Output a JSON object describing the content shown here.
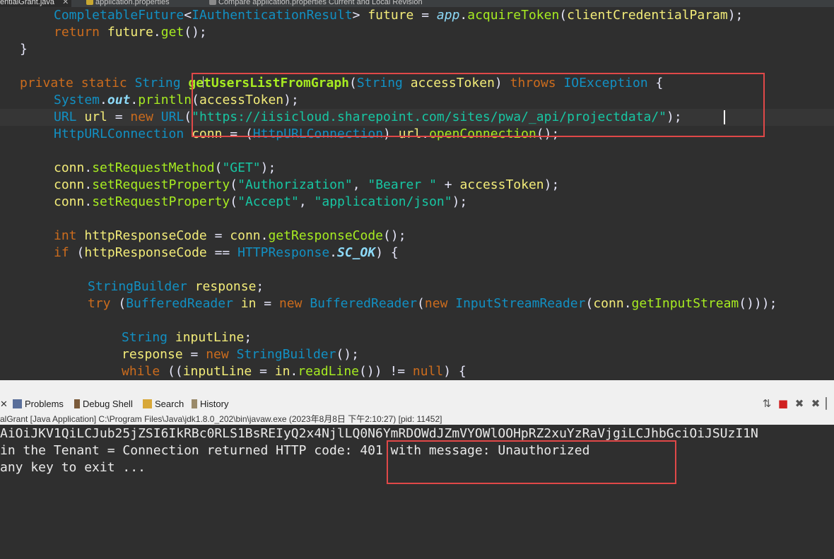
{
  "editor_tabs": [
    {
      "label": "entialGrant.java",
      "close": "✕"
    },
    {
      "label": "application.properties"
    },
    {
      "label": "Compare application.properties Current and Local Revision"
    }
  ],
  "code": {
    "l1": {
      "a": "CompletableFuture",
      "b": "<",
      "c": "IAuthenticationResult",
      "d": "> ",
      "e": "future",
      "f": " = ",
      "g": "app",
      "h": ".",
      "i": "acquireToken",
      "j": "(",
      "k": "clientCredentialParam",
      "l": ");"
    },
    "l2": {
      "a": "return ",
      "b": "future",
      "c": ".",
      "d": "get",
      "e": "();"
    },
    "l3": {
      "a": "}"
    },
    "l5": {
      "a": "private ",
      "b": "static ",
      "c": "String ",
      "d": "getUsersListFromGraph",
      "e": "(",
      "f": "String ",
      "g": "accessToken",
      "h": ") ",
      "i": "throws ",
      "j": "IOException",
      "k": " {"
    },
    "l6": {
      "a": "System",
      "b": ".",
      "c": "out",
      "d": ".",
      "e": "println",
      "f": "(",
      "g": "accessToken",
      "h": ");"
    },
    "l7": {
      "a": "URL ",
      "b": "url",
      "c": " = ",
      "d": "new ",
      "e": "URL",
      "f": "(",
      "g": "\"https://iisicloud.sharepoint.com/sites/pwa/_api/projectdata/\"",
      "h": ");"
    },
    "l8": {
      "a": "HttpURLConnection ",
      "b": "conn",
      "c": " = (",
      "d": "HttpURLConnection",
      "e": ") ",
      "f": "url",
      "g": ".",
      "h": "openConnection",
      "i": "();"
    },
    "l10": {
      "a": "conn",
      "b": ".",
      "c": "setRequestMethod",
      "d": "(",
      "e": "\"GET\"",
      "f": ");"
    },
    "l11": {
      "a": "conn",
      "b": ".",
      "c": "setRequestProperty",
      "d": "(",
      "e": "\"Authorization\"",
      "f": ", ",
      "g": "\"Bearer \"",
      "h": " + ",
      "i": "accessToken",
      "j": ");"
    },
    "l12": {
      "a": "conn",
      "b": ".",
      "c": "setRequestProperty",
      "d": "(",
      "e": "\"Accept\"",
      "f": ", ",
      "g": "\"application/json\"",
      "h": ");"
    },
    "l14": {
      "a": "int ",
      "b": "httpResponseCode",
      "c": " = ",
      "d": "conn",
      "e": ".",
      "f": "getResponseCode",
      "g": "();"
    },
    "l15": {
      "a": "if ",
      "b": "(",
      "c": "httpResponseCode",
      "d": " == ",
      "e": "HTTPResponse",
      "f": ".",
      "g": "SC_OK",
      "h": ") {"
    },
    "l17": {
      "a": "StringBuilder ",
      "b": "response",
      "c": ";"
    },
    "l18": {
      "a": "try ",
      "b": "(",
      "c": "BufferedReader ",
      "d": "in",
      "e": " = ",
      "f": "new ",
      "g": "BufferedReader",
      "h": "(",
      "i": "new ",
      "j": "InputStreamReader",
      "k": "(",
      "l": "conn",
      "m": ".",
      "n": "getInputStream",
      "o": "()));"
    },
    "l20": {
      "a": "String ",
      "b": "inputLine",
      "c": ";"
    },
    "l21": {
      "a": "response",
      "b": " = ",
      "c": "new ",
      "d": "StringBuilder",
      "e": "();"
    },
    "l22": {
      "a": "while ",
      "b": "((",
      "c": "inputLine",
      "d": " = ",
      "e": "in",
      "f": ".",
      "g": "readLine",
      "h": "()) != ",
      "i": "null",
      "j": ") {"
    }
  },
  "console_tabs": [
    {
      "label": "Problems",
      "icon": "problems-icon"
    },
    {
      "label": "Debug Shell",
      "icon": "debug-shell-icon"
    },
    {
      "label": "Search",
      "icon": "search-icon"
    },
    {
      "label": "History",
      "icon": "history-icon"
    }
  ],
  "console_tab_close": "✕",
  "console_desc": "alGrant [Java Application] C:\\Program Files\\Java\\jdk1.8.0_202\\bin\\javaw.exe  (2023年8月8日 下午2:10:27) [pid: 11452]",
  "console_lines": [
    "AiOiJKV1QiLCJub25jZSI6IkRBc0RLS1BsREIyQ2x4NjlLQ0N6YmRDOWdJZmVYOWlOOHpRZ2xuYzRaVjgiLCJhbGciOiJSUzI1N",
    "in the Tenant = Connection returned HTTP code: 401 with message: Unauthorized",
    "any key to exit ..."
  ],
  "colors": {
    "keyword": "#cc6c1d",
    "type": "#1290c3",
    "method": "#a7ec21",
    "string": "#17c6a3",
    "annotation_box": "#e04848"
  }
}
